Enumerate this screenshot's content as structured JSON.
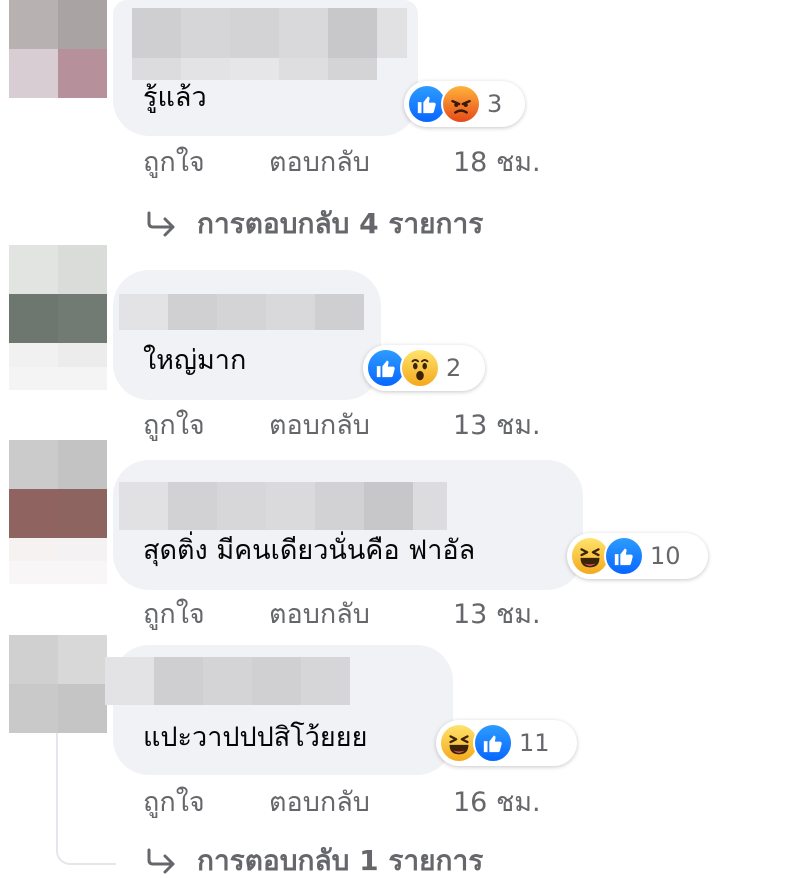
{
  "comments": [
    {
      "text": "รู้แล้ว",
      "reaction_count": "3",
      "reactions": [
        "like-icon",
        "angry-icon"
      ],
      "like_label": "ถูกใจ",
      "reply_label": "ตอบกลับ",
      "time": "18 ชม.",
      "view_replies": "การตอบกลับ 4 รายการ"
    },
    {
      "text": "ใหญ่มาก",
      "reaction_count": "2",
      "reactions": [
        "like-icon",
        "wow-icon"
      ],
      "like_label": "ถูกใจ",
      "reply_label": "ตอบกลับ",
      "time": "13 ชม."
    },
    {
      "text": "สุดติ่ง มีคนเดียวนั่นคือ ฟาอัล",
      "reaction_count": "10",
      "reactions": [
        "haha-icon",
        "like-icon"
      ],
      "like_label": "ถูกใจ",
      "reply_label": "ตอบกลับ",
      "time": "13 ชม."
    },
    {
      "text": "แปะวาปปปสิโว้ยยย",
      "reaction_count": "11",
      "reactions": [
        "haha-icon",
        "like-icon"
      ],
      "like_label": "ถูกใจ",
      "reply_label": "ตอบกลับ",
      "time": "16 ชม.",
      "view_replies": "การตอบกลับ 1 รายการ"
    }
  ],
  "colors": {
    "bubble": "#f0f2f5",
    "meta_text": "#65676b",
    "like_blue": "#0866ff"
  }
}
